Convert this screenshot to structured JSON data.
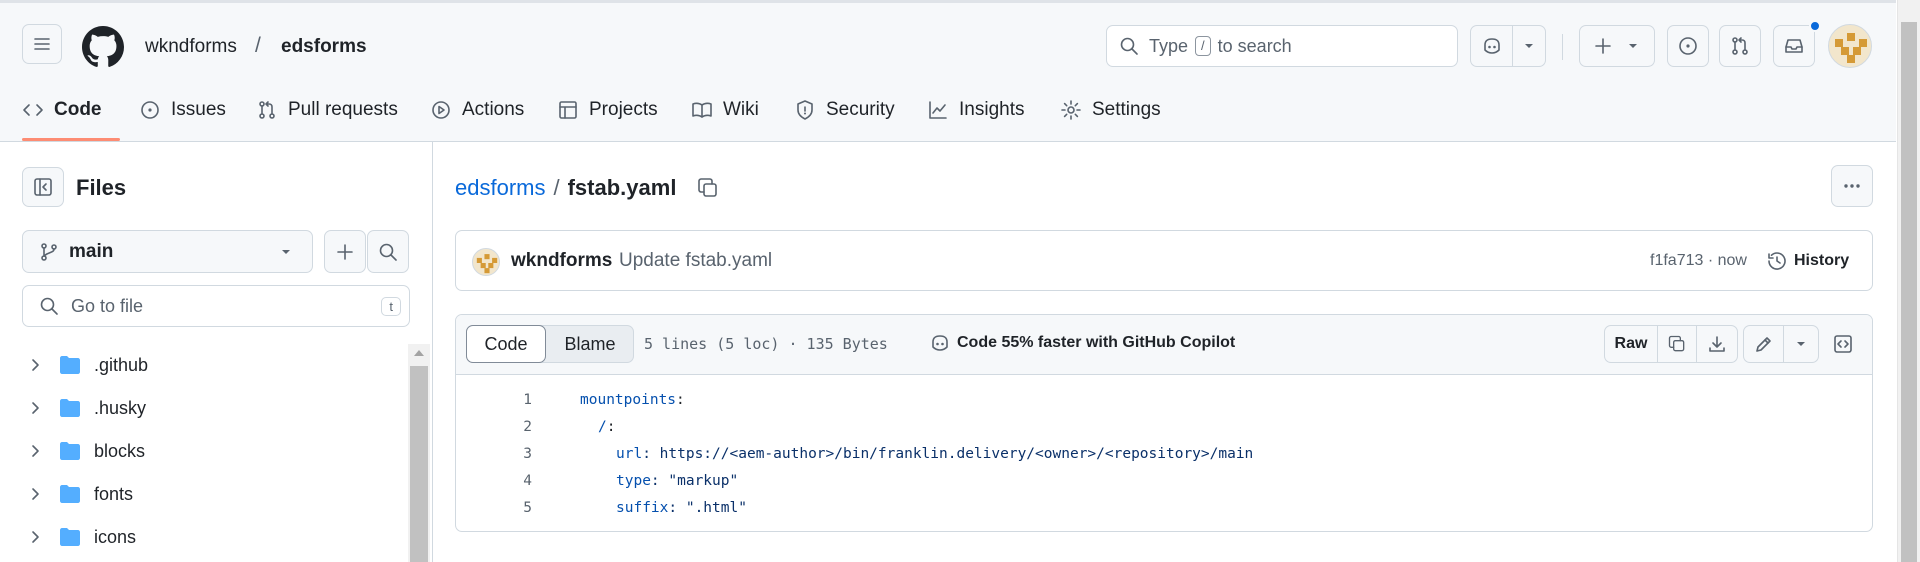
{
  "header": {
    "owner": "wkndforms",
    "separator": "/",
    "repo": "edsforms",
    "search_placeholder_pre": "Type",
    "search_key": "/",
    "search_placeholder_post": "to search",
    "notification_dot_color": "#0969da"
  },
  "tabs": [
    {
      "label": "Code",
      "icon": "code-icon",
      "selected": true
    },
    {
      "label": "Issues",
      "icon": "issue-opened-icon"
    },
    {
      "label": "Pull requests",
      "icon": "git-pull-request-icon"
    },
    {
      "label": "Actions",
      "icon": "play-icon"
    },
    {
      "label": "Projects",
      "icon": "table-icon"
    },
    {
      "label": "Wiki",
      "icon": "book-icon"
    },
    {
      "label": "Security",
      "icon": "shield-icon"
    },
    {
      "label": "Insights",
      "icon": "graph-icon"
    },
    {
      "label": "Settings",
      "icon": "gear-icon"
    }
  ],
  "sidebar": {
    "title": "Files",
    "branch": "main",
    "goto_placeholder": "Go to file",
    "goto_key": "t",
    "tree": [
      {
        "name": ".github"
      },
      {
        "name": ".husky"
      },
      {
        "name": "blocks"
      },
      {
        "name": "fonts"
      },
      {
        "name": "icons"
      }
    ]
  },
  "file": {
    "repo_link": "edsforms",
    "separator": "/",
    "name": "fstab.yaml"
  },
  "commit": {
    "author": "wkndforms",
    "message": "Update fstab.yaml",
    "sha_time": "f1fa713 · now",
    "history_label": "History"
  },
  "viewer": {
    "code_tab": "Code",
    "blame_tab": "Blame",
    "stats": "5 lines (5 loc) · 135 Bytes",
    "copilot_promo": "Code 55% faster with GitHub Copilot",
    "raw_label": "Raw"
  },
  "code_lines": [
    {
      "num": "1",
      "key": "mountpoints",
      "rest": ":",
      "indent": 0
    },
    {
      "num": "2",
      "key": "/",
      "rest": ":",
      "indent": 1
    },
    {
      "num": "3",
      "key": "url",
      "rest": ": https://<aem-author>/bin/franklin.delivery/<owner>/<repository>/main",
      "indent": 2
    },
    {
      "num": "4",
      "key": "type",
      "rest": ": \"markup\"",
      "indent": 2
    },
    {
      "num": "5",
      "key": "suffix",
      "rest": ": \".html\"",
      "indent": 2
    }
  ],
  "colors": {
    "accent_underline": "#fd8c73",
    "link_blue": "#0969da",
    "yaml_key": "#0550ae",
    "folder_blue": "#54aeff"
  }
}
